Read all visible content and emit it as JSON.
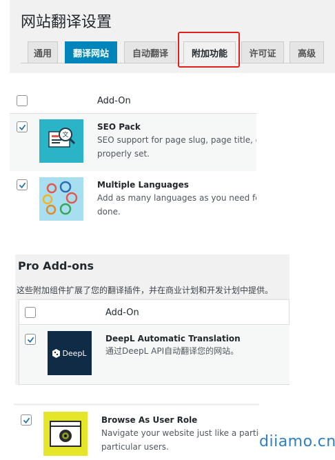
{
  "header": {
    "title": "网站翻译设置",
    "tabs": [
      {
        "label": "通用"
      },
      {
        "label": "翻译网站"
      },
      {
        "label": "自动翻译"
      },
      {
        "label": "附加功能"
      },
      {
        "label": "许可证"
      },
      {
        "label": "高级"
      }
    ]
  },
  "addons": {
    "column_header": "Add-On",
    "items": [
      {
        "name": "SEO Pack",
        "desc_line1": "SEO support for page slug, page title, de",
        "desc_line2": "properly set.",
        "checked": true
      },
      {
        "name": "Multiple Languages",
        "desc_line1": "Add as many languages as you need for",
        "desc_line2": "done.",
        "checked": true
      }
    ]
  },
  "pro": {
    "title": "Pro Add-ons",
    "description": "这些附加组件扩展了您的翻译插件，并在商业计划和开发计划中提供。",
    "column_header": "Add-On",
    "items": [
      {
        "name": "DeepL Automatic Translation",
        "desc_line1": "通过DeepL API自动翻译您的网站。",
        "logo_text": "DeepL",
        "checked": true
      },
      {
        "name": "Browse As User Role",
        "desc_line1": "Navigate your website just like a particu",
        "desc_line2": "particular users.",
        "checked": true
      }
    ]
  },
  "watermark": "diiamo.cn",
  "colors": {
    "accent": "#0085ba",
    "highlight": "#e0201c",
    "deepl_bg": "#0f2b46",
    "seo_bg": "#2bb3c8",
    "lang_bg": "#a8dff0",
    "role_bg": "#e5e52a"
  }
}
